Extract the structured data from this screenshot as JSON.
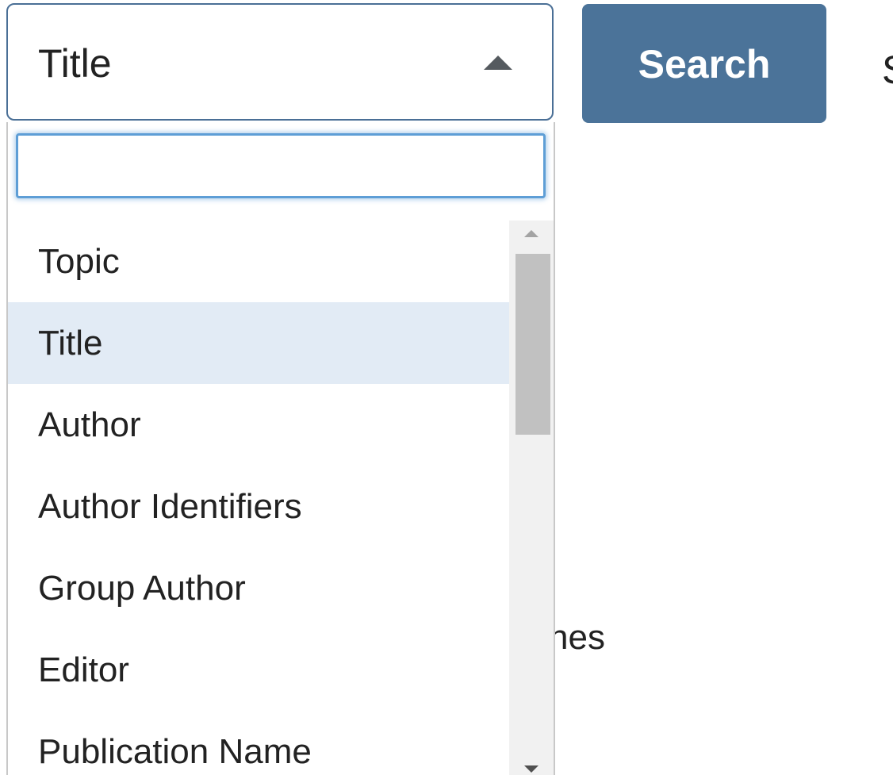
{
  "search_field_select": {
    "selected_label": "Title",
    "state": "open"
  },
  "search_button": {
    "label": "Search"
  },
  "partial_edge_text": "S",
  "partial_background_text": "nes",
  "dropdown": {
    "filter_value": "",
    "options": [
      {
        "label": "Topic",
        "selected": false
      },
      {
        "label": "Title",
        "selected": true
      },
      {
        "label": "Author",
        "selected": false
      },
      {
        "label": "Author Identifiers",
        "selected": false
      },
      {
        "label": "Group Author",
        "selected": false
      },
      {
        "label": "Editor",
        "selected": false
      },
      {
        "label": "Publication Name",
        "selected": false
      }
    ],
    "scroll_position_fraction": 0.0
  },
  "colors": {
    "accent": "#4b7399",
    "select_border": "#4a6f96",
    "focus_ring": "#5e9ed6",
    "selected_option_bg": "#e2ebf5"
  },
  "icons": {
    "select_arrow": "caret-up-icon",
    "scroll_up": "scroll-up-arrow-icon",
    "scroll_down": "scroll-down-arrow-icon"
  }
}
